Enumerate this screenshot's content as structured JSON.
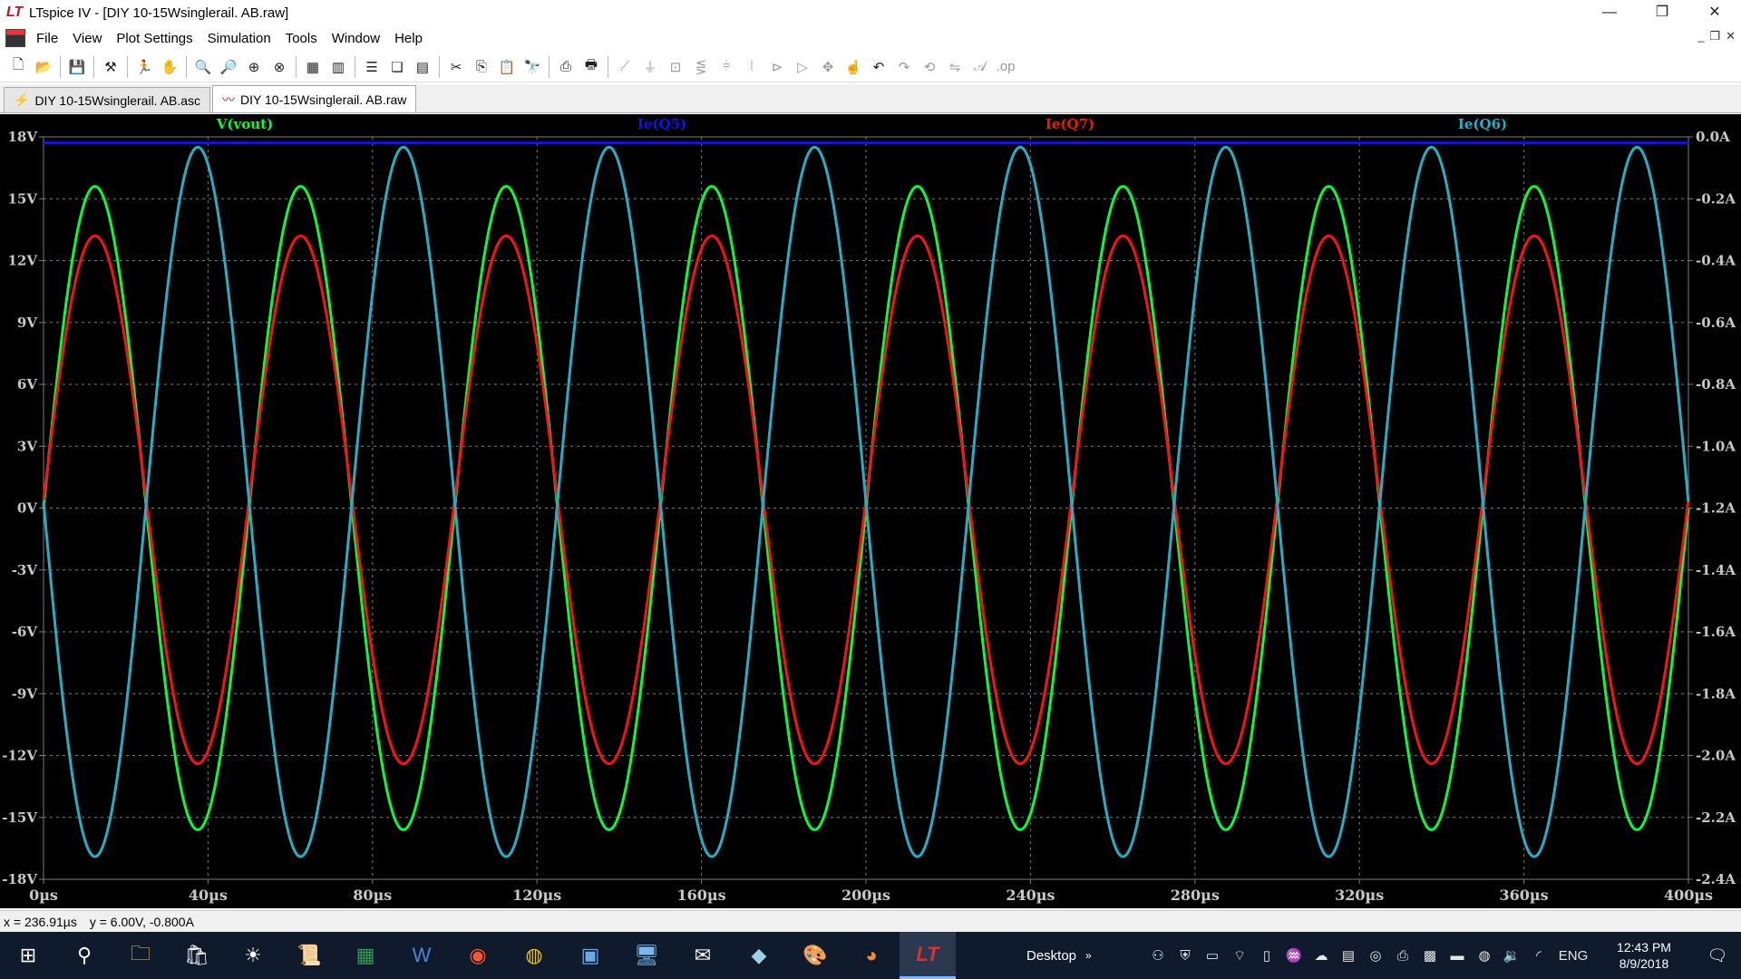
{
  "window": {
    "title": "LTspice IV - [DIY 10-15Wsinglerail. AB.raw]",
    "controls": {
      "minimize": "—",
      "restore": "❐",
      "close": "✕"
    }
  },
  "menu": [
    {
      "label": "File"
    },
    {
      "label": "View"
    },
    {
      "label": "Plot Settings"
    },
    {
      "label": "Simulation"
    },
    {
      "label": "Tools"
    },
    {
      "label": "Window"
    },
    {
      "label": "Help"
    }
  ],
  "tabs": [
    {
      "label": "DIY 10-15Wsinglerail. AB.asc",
      "icon": "schematic-icon"
    },
    {
      "label": "DIY 10-15Wsinglerail. AB.raw",
      "icon": "waveform-icon"
    }
  ],
  "status": {
    "x_readout": "x = 236.91µs",
    "y_readout": "y = 6.00V, -0.800A"
  },
  "taskbar": {
    "desktop_label": "Desktop",
    "language": "ENG",
    "time": "12:43 PM",
    "date": "8/9/2018"
  },
  "colors": {
    "plot_bg": "#000000",
    "grid": "#7a7a7a",
    "axis_text": "#c8c8c8",
    "vout": "#00ff33",
    "ie_q5": "#1010ff",
    "ie_q7": "#ff1010",
    "ie_q6": "#22b0c8"
  },
  "chart_data": {
    "type": "line",
    "xlabel": "",
    "ylabel": "",
    "xlim": [
      0,
      400
    ],
    "x_unit": "µs",
    "ylim_left": [
      -18,
      18
    ],
    "ylim_right": [
      -2.4,
      0.0
    ],
    "x_ticks": [
      "0µs",
      "40µs",
      "80µs",
      "120µs",
      "160µs",
      "200µs",
      "240µs",
      "280µs",
      "320µs",
      "360µs",
      "400µs"
    ],
    "x_tick_values": [
      0,
      40,
      80,
      120,
      160,
      200,
      240,
      280,
      320,
      360,
      400
    ],
    "y_ticks_left": [
      "18V",
      "15V",
      "12V",
      "9V",
      "6V",
      "3V",
      "0V",
      "-3V",
      "-6V",
      "-9V",
      "-12V",
      "-15V",
      "-18V"
    ],
    "y_tick_values_left": [
      18,
      15,
      12,
      9,
      6,
      3,
      0,
      -3,
      -6,
      -9,
      -12,
      -15,
      -18
    ],
    "y_ticks_right": [
      "0.0A",
      "-0.2A",
      "-0.4A",
      "-0.6A",
      "-0.8A",
      "-1.0A",
      "-1.2A",
      "-1.4A",
      "-1.6A",
      "-1.8A",
      "-2.0A",
      "-2.2A",
      "-2.4A"
    ],
    "y_tick_values_right": [
      0.0,
      -0.2,
      -0.4,
      -0.6,
      -0.8,
      -1.0,
      -1.2,
      -1.4,
      -1.6,
      -1.8,
      -2.0,
      -2.2,
      -2.4
    ],
    "grid": true,
    "series": [
      {
        "name": "V(vout)",
        "axis": "left",
        "kind": "sine",
        "frequency_khz": 20,
        "amplitude": 15.6,
        "offset": 0,
        "phase_deg": 0
      },
      {
        "name": "Ie(Q5)",
        "axis": "right",
        "kind": "flat",
        "value": -0.02
      },
      {
        "name": "Ie(Q7)",
        "axis": "left",
        "kind": "sine",
        "frequency_khz": 20,
        "amplitude": 12.8,
        "offset": 0.4,
        "phase_deg": 0
      },
      {
        "name": "Ie(Q6)",
        "axis": "left",
        "kind": "sine",
        "frequency_khz": 20,
        "amplitude": 17.2,
        "offset": 0.3,
        "phase_deg": 180
      }
    ]
  }
}
